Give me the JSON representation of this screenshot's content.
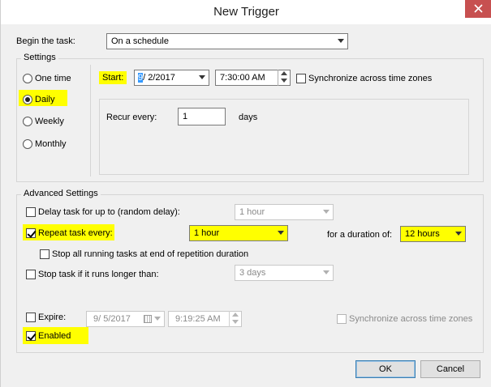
{
  "window": {
    "title": "New Trigger",
    "close_icon": "close-icon"
  },
  "begin": {
    "label": "Begin the task:",
    "value": "On a schedule"
  },
  "settings": {
    "title": "Settings",
    "radios": [
      {
        "label": "One time",
        "selected": false
      },
      {
        "label": "Daily",
        "selected": true
      },
      {
        "label": "Weekly",
        "selected": false
      },
      {
        "label": "Monthly",
        "selected": false
      }
    ],
    "start_label": "Start:",
    "start_date_cursor": "9",
    "start_date_rest": "/  2/2017",
    "start_time": "7:30:00 AM",
    "sync_label": "Synchronize across time zones",
    "recur_label": "Recur every:",
    "recur_value": "1",
    "recur_unit": "days"
  },
  "advanced": {
    "title": "Advanced Settings",
    "delay_label": "Delay task for up to (random delay):",
    "delay_value": "1 hour",
    "repeat_label": "Repeat task every:",
    "repeat_value": "1 hour",
    "duration_label": "for a duration of:",
    "duration_value": "12 hours",
    "stop_all_label": "Stop all running tasks at end of repetition duration",
    "stop_longer_label": "Stop task if it runs longer than:",
    "stop_longer_value": "3 days",
    "expire_label": "Expire:",
    "expire_date": "9/  5/2017",
    "expire_time": "9:19:25 AM",
    "expire_sync_label": "Synchronize across time zones",
    "enabled_label": "Enabled"
  },
  "buttons": {
    "ok": "OK",
    "cancel": "Cancel"
  }
}
